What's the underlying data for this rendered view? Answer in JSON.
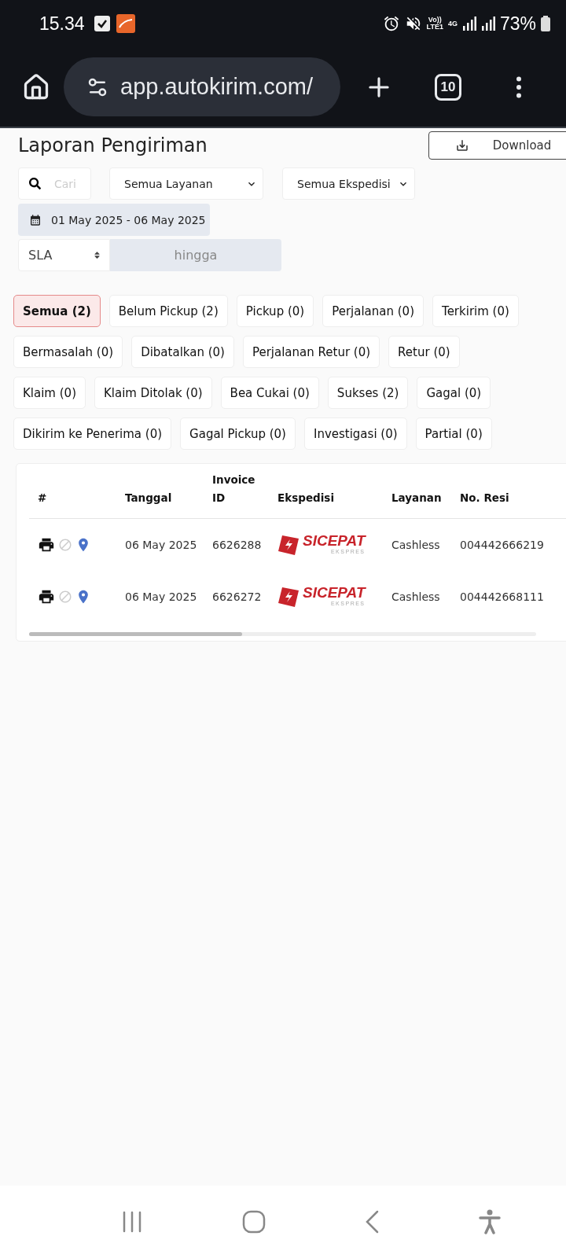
{
  "status_bar": {
    "time": "15.34",
    "volte": "Vo))",
    "volte_sub": "LTE1",
    "network": "4G",
    "battery": "73%"
  },
  "browser": {
    "url": "app.autokirim.com/",
    "tab_count": "10"
  },
  "page": {
    "title": "Laporan Pengiriman",
    "download_button": "Download"
  },
  "filters": {
    "search_placeholder": "Cari",
    "service_select": "Semua Layanan",
    "courier_select": "Semua Ekspedisi",
    "date_range": "01 May 2025 - 06 May 2025",
    "sla_select": "SLA",
    "range_placeholder": "hingga"
  },
  "status_tab_rows": [
    [
      {
        "label": "Semua (2)",
        "selected": true
      },
      {
        "label": "Belum Pickup (2)",
        "selected": false
      },
      {
        "label": "Pickup (0)",
        "selected": false
      },
      {
        "label": "Perjalanan (0)",
        "selected": false
      },
      {
        "label": "Terkirim (0)",
        "selected": false
      }
    ],
    [
      {
        "label": "Bermasalah (0)",
        "selected": false
      },
      {
        "label": "Dibatalkan (0)",
        "selected": false
      },
      {
        "label": "Perjalanan Retur (0)",
        "selected": false
      },
      {
        "label": "Retur (0)",
        "selected": false
      }
    ],
    [
      {
        "label": "Klaim (0)",
        "selected": false
      },
      {
        "label": "Klaim Ditolak (0)",
        "selected": false
      },
      {
        "label": "Bea Cukai (0)",
        "selected": false
      },
      {
        "label": "Sukses (2)",
        "selected": false
      },
      {
        "label": "Gagal (0)",
        "selected": false
      }
    ],
    [
      {
        "label": "Dikirim ke Penerima (0)",
        "selected": false
      },
      {
        "label": "Gagal Pickup (0)",
        "selected": false
      },
      {
        "label": "Investigasi (0)",
        "selected": false
      },
      {
        "label": "Partial (0)",
        "selected": false
      }
    ]
  ],
  "table": {
    "columns": [
      "#",
      "Tanggal",
      "Invoice ID",
      "Ekspedisi",
      "Layanan",
      "No. Resi"
    ],
    "rows": [
      {
        "date": "06 May 2025",
        "invoice_id": "6626288",
        "courier": {
          "name": "SICEPAT",
          "sub": "EKSPRES"
        },
        "service": "Cashless",
        "tracking_no": "004442666219"
      },
      {
        "date": "06 May 2025",
        "invoice_id": "6626272",
        "courier": {
          "name": "SICEPAT",
          "sub": "EKSPRES"
        },
        "service": "Cashless",
        "tracking_no": "004442668111"
      }
    ]
  }
}
